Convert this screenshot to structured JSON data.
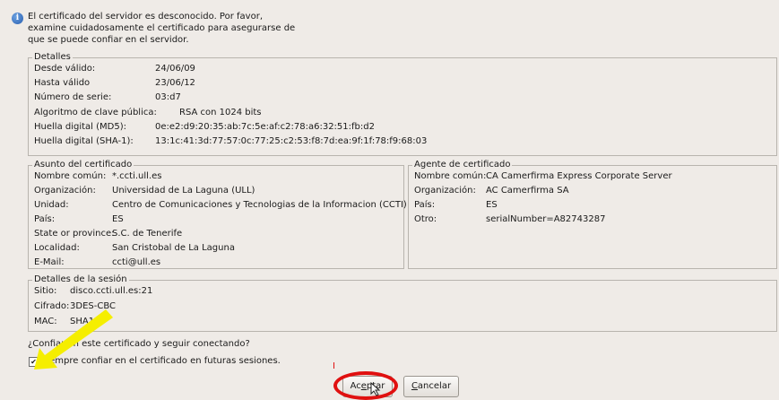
{
  "message": {
    "line1": "El certificado del servidor es desconocido. Por favor,",
    "line2": "examine cuidadosamente el certificado para asegurarse de",
    "line3": "que se puede confiar en el servidor."
  },
  "details": {
    "title": "Detalles",
    "rows": [
      {
        "label": "Desde válido:",
        "value": "24/06/09"
      },
      {
        "label": "Hasta válido",
        "value": "23/06/12"
      },
      {
        "label": "Número de serie:",
        "value": "03:d7"
      },
      {
        "label": "Algoritmo de clave pública:",
        "value": "RSA con 1024 bits"
      },
      {
        "label": "Huella digital (MD5):",
        "value": "0e:e2:d9:20:35:ab:7c:5e:af:c2:78:a6:32:51:fb:d2"
      },
      {
        "label": "Huella digital (SHA-1):",
        "value": "13:1c:41:3d:77:57:0c:77:25:c2:53:f8:7d:ea:9f:1f:78:f9:68:03"
      }
    ]
  },
  "subject": {
    "title": "Asunto del certificado",
    "rows": [
      {
        "label": "Nombre común:",
        "value": "*.ccti.ull.es"
      },
      {
        "label": "Organización:",
        "value": "Universidad de La Laguna (ULL)"
      },
      {
        "label": "Unidad:",
        "value": "Centro de Comunicaciones y Tecnologias de la Informacion (CCTI)"
      },
      {
        "label": "País:",
        "value": "ES"
      },
      {
        "label": "State or province:",
        "value": "S.C. de Tenerife"
      },
      {
        "label": "Localidad:",
        "value": "San Cristobal de La Laguna"
      },
      {
        "label": "E-Mail:",
        "value": "ccti@ull.es"
      }
    ]
  },
  "issuer": {
    "title": "Agente de certificado",
    "rows": [
      {
        "label": "Nombre común:",
        "value": "CA Camerfirma Express Corporate Server"
      },
      {
        "label": "Organización:",
        "value": "AC Camerfirma SA"
      },
      {
        "label": "País:",
        "value": "ES"
      },
      {
        "label": "Otro:",
        "value": "serialNumber=A82743287"
      }
    ]
  },
  "session": {
    "title": "Detalles de la sesión",
    "rows": [
      {
        "label": "Sitio:",
        "value": "disco.ccti.ull.es:21"
      },
      {
        "label": "Cifrado:",
        "value": "3DES-CBC"
      },
      {
        "label": "MAC:",
        "value": "SHA1"
      }
    ]
  },
  "question": "¿Confiar en este certificado y seguir conectando?",
  "checkbox": {
    "label": "Siempre confiar en el certificado en futuras sesiones.",
    "checked": true
  },
  "buttons": {
    "accept_pre": "Ac",
    "accept_ul": "e",
    "accept_post": "ptar",
    "cancel_ul": "C",
    "cancel_post": "ancelar"
  },
  "annotation_colors": {
    "arrow": "#f5ee00",
    "ellipse": "#e01010"
  }
}
